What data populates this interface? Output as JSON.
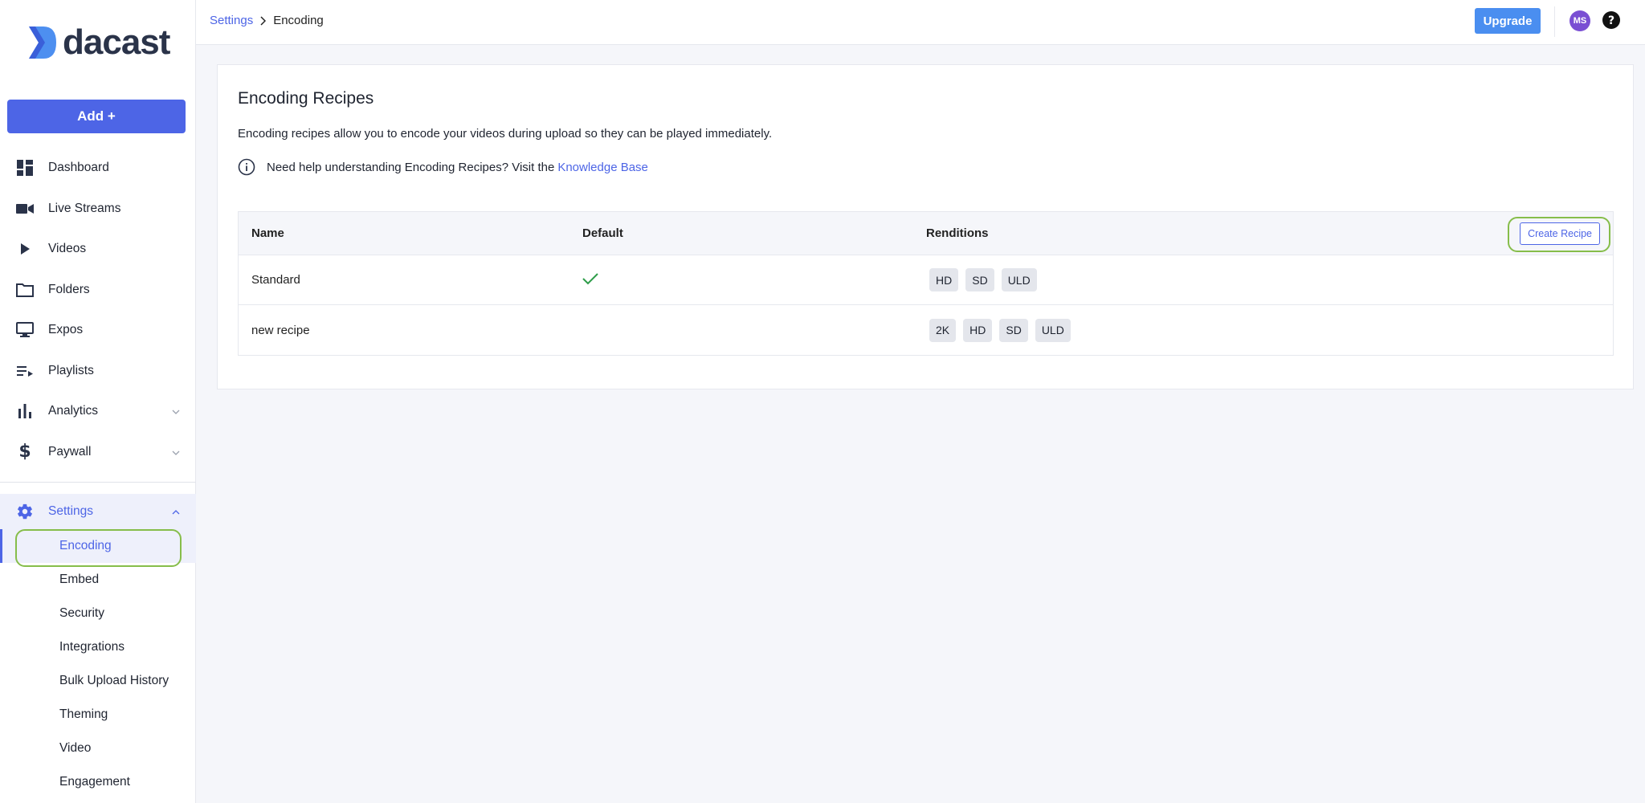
{
  "brand": {
    "name": "dacast",
    "accent": "#4d65e6",
    "highlight": "#86bd4a"
  },
  "sidebar": {
    "add_label": "Add +",
    "items": [
      {
        "label": "Dashboard",
        "icon": "dashboard-icon"
      },
      {
        "label": "Live Streams",
        "icon": "video-camera-icon"
      },
      {
        "label": "Videos",
        "icon": "play-icon"
      },
      {
        "label": "Folders",
        "icon": "folder-icon"
      },
      {
        "label": "Expos",
        "icon": "monitor-icon"
      },
      {
        "label": "Playlists",
        "icon": "playlist-icon"
      },
      {
        "label": "Analytics",
        "icon": "bar-chart-icon",
        "expandable": true
      },
      {
        "label": "Paywall",
        "icon": "dollar-icon",
        "expandable": true
      }
    ],
    "settings": {
      "label": "Settings",
      "icon": "gear-icon",
      "expanded": true,
      "children": [
        {
          "label": "Encoding",
          "active": true
        },
        {
          "label": "Embed"
        },
        {
          "label": "Security"
        },
        {
          "label": "Integrations"
        },
        {
          "label": "Bulk Upload History"
        },
        {
          "label": "Theming"
        },
        {
          "label": "Video"
        },
        {
          "label": "Engagement"
        }
      ]
    }
  },
  "header": {
    "breadcrumb": {
      "parent": "Settings",
      "current": "Encoding"
    },
    "upgrade_label": "Upgrade",
    "avatar_initials": "MS"
  },
  "main": {
    "title": "Encoding Recipes",
    "description": "Encoding recipes allow you to encode your videos during upload so they can be played immediately.",
    "help_text": "Need help understanding Encoding Recipes? Visit the",
    "help_link": "Knowledge Base",
    "table": {
      "columns": [
        "Name",
        "Default",
        "Renditions"
      ],
      "create_label": "Create Recipe",
      "rows": [
        {
          "name": "Standard",
          "default": true,
          "renditions": [
            "HD",
            "SD",
            "ULD"
          ]
        },
        {
          "name": "new recipe",
          "default": false,
          "renditions": [
            "2K",
            "HD",
            "SD",
            "ULD"
          ]
        }
      ]
    }
  }
}
